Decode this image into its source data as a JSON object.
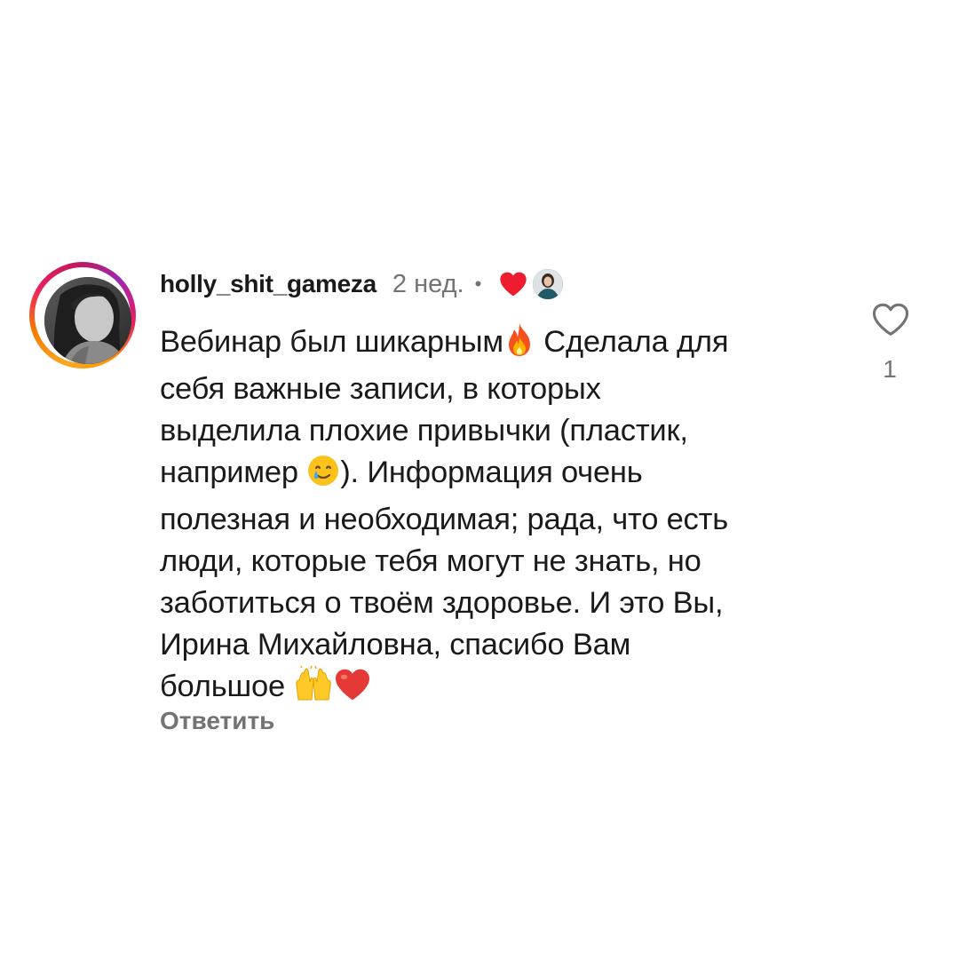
{
  "comment": {
    "username": "holly_shit_gameza",
    "time": "2 нед.",
    "separator": "•",
    "lines": [
      [
        "Вебинар был шикарным",
        "fire-emoji",
        " Сделала для"
      ],
      [
        "себя важные записи, в которых"
      ],
      [
        "выделила плохие привычки (пластик,"
      ],
      [
        "например ",
        "smiling-face-with-tear-emoji",
        "). Информация очень"
      ],
      [
        "полезная и необходимая; рада, что есть"
      ],
      [
        "люди, которые тебя могут не знать, но"
      ],
      [
        "заботиться о твоём здоровье. И это Вы,"
      ],
      [
        "Ирина Михайловна, спасибо Вам"
      ],
      [
        "большое ",
        "raising-hands-emoji",
        "red-heart-emoji"
      ]
    ],
    "reply_label": "Ответить",
    "like_count": "1",
    "author_liked": true
  },
  "icons": {
    "liked_by_author": "red-heart-icon",
    "like_button": "heart-outline-icon"
  },
  "colors": {
    "text": "#1a1a1a",
    "secondary": "#737373",
    "heart_red": "#ed1c2e",
    "ring_gradient": [
      "#f9a825",
      "#e91e63",
      "#9c27b0"
    ]
  }
}
